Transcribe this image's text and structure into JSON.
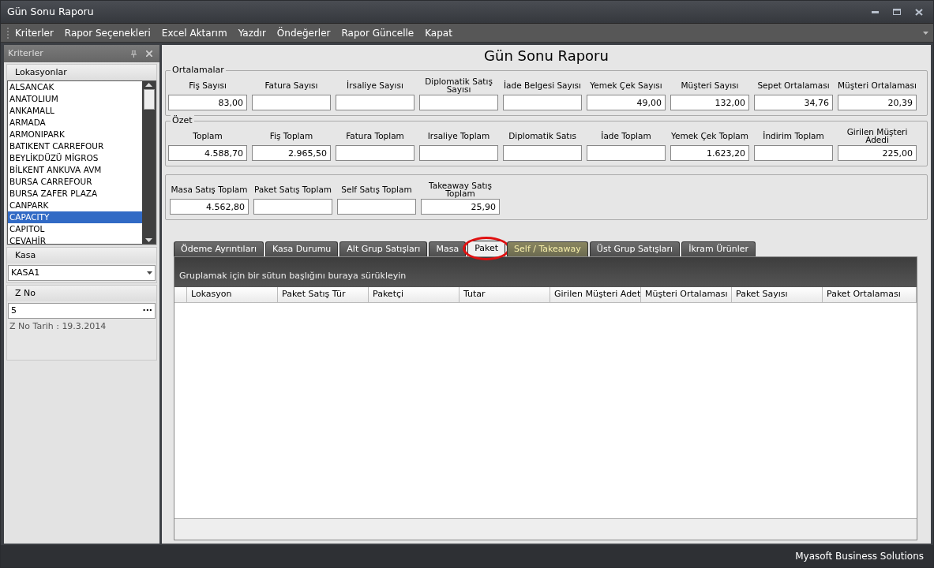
{
  "window": {
    "title": "Gün Sonu Raporu"
  },
  "menu": [
    "Kriterler",
    "Rapor Seçenekleri",
    "Excel Aktarım",
    "Yazdır",
    "Öndeğerler",
    "Rapor Güncelle",
    "Kapat"
  ],
  "sidebar": {
    "title": "Kriterler",
    "locations_label": "Lokasyonlar",
    "locations": [
      {
        "label": "ALSANCAK",
        "selected": false
      },
      {
        "label": "ANATOLIUM",
        "selected": false
      },
      {
        "label": "ANKAMALL",
        "selected": false
      },
      {
        "label": "ARMADA",
        "selected": false
      },
      {
        "label": "ARMONIPARK",
        "selected": false
      },
      {
        "label": "BATIKENT CARREFOUR",
        "selected": false
      },
      {
        "label": "BEYLİKDÜZÜ MİGROS",
        "selected": false
      },
      {
        "label": "BİLKENT ANKUVA AVM",
        "selected": false
      },
      {
        "label": "BURSA CARREFOUR",
        "selected": false
      },
      {
        "label": "BURSA ZAFER PLAZA",
        "selected": false
      },
      {
        "label": "CANPARK",
        "selected": false
      },
      {
        "label": "CAPACITY",
        "selected": true
      },
      {
        "label": "CAPITOL",
        "selected": false
      },
      {
        "label": "CEVAHİR",
        "selected": false
      }
    ],
    "kasa_label": "Kasa",
    "kasa_value": "KASA1",
    "zno_label": "Z No",
    "zno_value": "5",
    "zno_button": "···",
    "zno_date": "Z No Tarih : 19.3.2014"
  },
  "report_title": "Gün Sonu Raporu",
  "groups": [
    {
      "title": "Ortalamalar",
      "fields": [
        {
          "label": "Fiş Sayısı",
          "value": "83,00"
        },
        {
          "label": "Fatura Sayısı"
        },
        {
          "label": "İrsaliye Sayısı"
        },
        {
          "label": "Diplomatik Satış Sayısı"
        },
        {
          "label": "İade Belgesi Sayısı"
        },
        {
          "label": "Yemek Çek Sayısı",
          "value": "49,00"
        },
        {
          "label": "Müşteri Sayısı",
          "value": "132,00"
        },
        {
          "label": "Sepet Ortalaması",
          "value": "34,76"
        },
        {
          "label": "Müşteri Ortalaması",
          "value": "20,39"
        }
      ]
    },
    {
      "title": "Özet",
      "fields": [
        {
          "label": "Toplam",
          "value": "4.588,70"
        },
        {
          "label": "Fiş Toplam",
          "value": "2.965,50"
        },
        {
          "label": "Fatura Toplam"
        },
        {
          "label": "Irsaliye Toplam"
        },
        {
          "label": "Diplomatik Satıs"
        },
        {
          "label": "İade Toplam"
        },
        {
          "label": "Yemek Çek Toplam",
          "value": "1.623,20"
        },
        {
          "label": "İndirim Toplam"
        },
        {
          "label": "Girilen Müşteri Adedi",
          "value": "225,00"
        }
      ]
    },
    {
      "fields": [
        {
          "label": "Masa Satış Toplam",
          "value": "4.562,80"
        },
        {
          "label": "Paket Satış Toplam"
        },
        {
          "label": "Self Satış Toplam"
        },
        {
          "label": "Takeaway Satış Toplam",
          "value": "25,90"
        }
      ]
    }
  ],
  "tabs": [
    {
      "label": "Ödeme Ayrıntıları",
      "selected": false,
      "hovered": false,
      "circled": false
    },
    {
      "label": "Kasa Durumu",
      "selected": false,
      "hovered": false,
      "circled": false
    },
    {
      "label": "Alt Grup Satışları",
      "selected": false,
      "hovered": false,
      "circled": false
    },
    {
      "label": "Masa",
      "selected": false,
      "hovered": false,
      "circled": false
    },
    {
      "label": "Paket",
      "selected": true,
      "hovered": false,
      "circled": true
    },
    {
      "label": "Self / Takeaway",
      "selected": false,
      "hovered": true,
      "circled": false
    },
    {
      "label": "Üst Grup Satışları",
      "selected": false,
      "hovered": false,
      "circled": false
    },
    {
      "label": "İkram Ürünler",
      "selected": false,
      "hovered": false,
      "circled": false
    }
  ],
  "table": {
    "group_hint": "Gruplamak için bir sütun başlığını buraya sürükleyin",
    "columns": [
      "Lokasyon",
      "Paket Satış Tür",
      "Paketçi",
      "Tutar",
      "Girilen Müşteri Adet",
      "Müşteri Ortalaması",
      "Paket Sayısı",
      "Paket Ortalaması"
    ]
  },
  "status_bar": "Myasoft Business Solutions"
}
